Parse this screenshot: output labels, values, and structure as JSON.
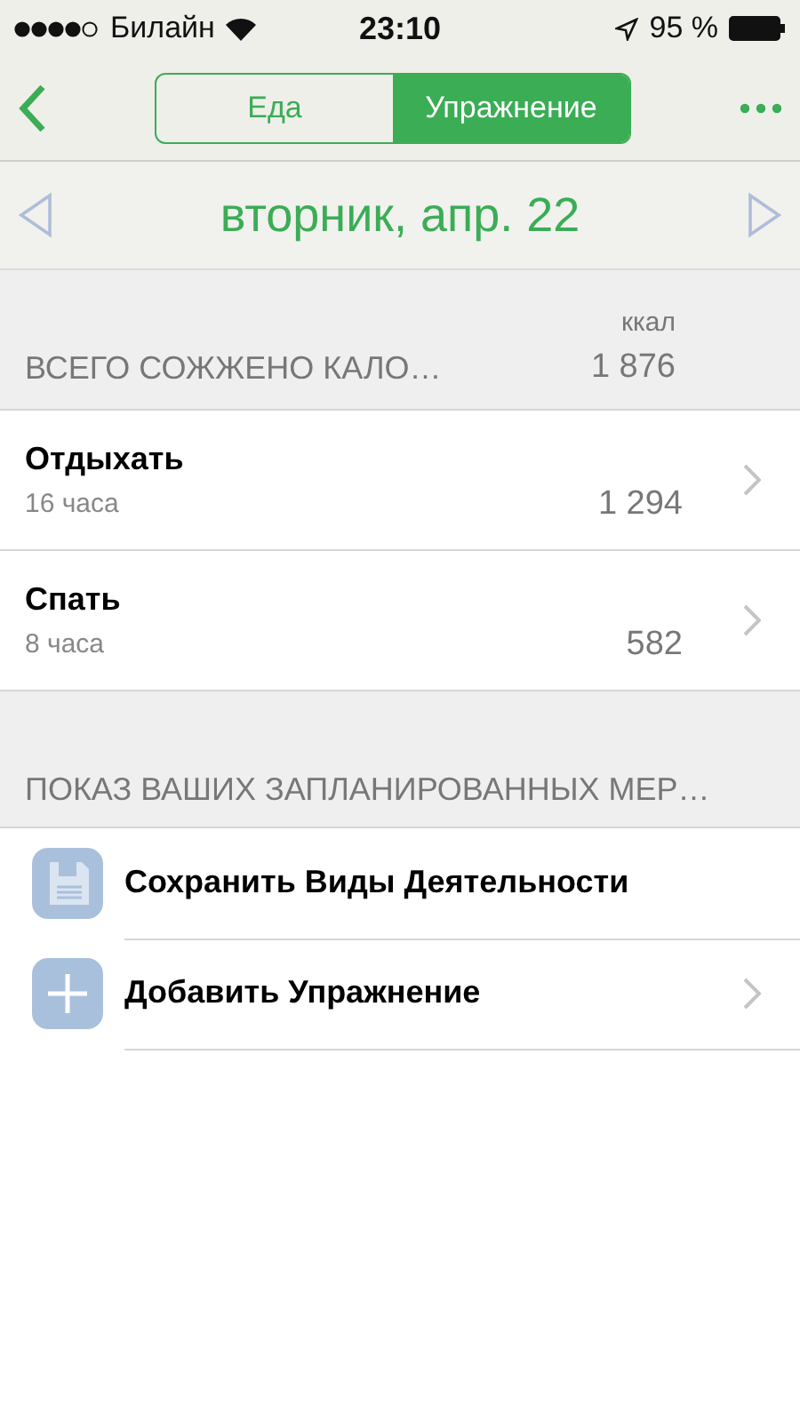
{
  "status_bar": {
    "carrier": "Билайн",
    "time": "23:10",
    "battery": "95 %"
  },
  "nav": {
    "tabs": [
      {
        "label": "Еда",
        "selected": false
      },
      {
        "label": "Упражнение",
        "selected": true
      }
    ]
  },
  "date_bar": {
    "date": "вторник, апр. 22"
  },
  "summary": {
    "title": "ВСЕГО СОЖЖЕНО КАЛО…",
    "unit": "ккал",
    "total": "1 876"
  },
  "activities": [
    {
      "name": "Отдыхать",
      "duration": "16 часа",
      "calories": "1 294"
    },
    {
      "name": "Спать",
      "duration": "8 часа",
      "calories": "582"
    }
  ],
  "planned": {
    "title": "ПОКАЗ ВАШИХ ЗАПЛАНИРОВАННЫХ МЕР…",
    "actions": [
      {
        "kind": "save",
        "label": "Сохранить Виды Деятельности",
        "chevron": false
      },
      {
        "kind": "add",
        "label": "Добавить Упражнение",
        "chevron": true
      }
    ]
  }
}
